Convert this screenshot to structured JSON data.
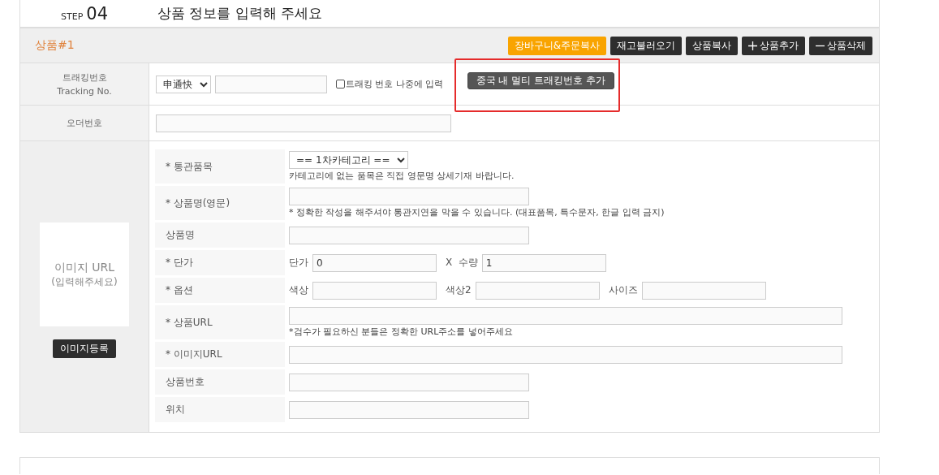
{
  "step": {
    "label": "STEP",
    "number": "04",
    "title": "상품 정보를 입력해 주세요"
  },
  "product": {
    "title": "상품#1",
    "actions": [
      {
        "label": "장바구니&주문복사",
        "kind": "highlight"
      },
      {
        "label": "재고불러오기",
        "kind": "plain"
      },
      {
        "label": "상품복사",
        "kind": "plain"
      },
      {
        "label": "상품추가",
        "kind": "add"
      },
      {
        "label": "상품삭제",
        "kind": "remove"
      }
    ],
    "tracking": {
      "label": "트래킹번호",
      "sublabel": "Tracking No.",
      "carrier": "申通快",
      "later_label": "트래킹 번호 나중에 입력",
      "later_checked": false,
      "multi_button": "중국 내 멀티 트래킹번호 추가",
      "multi_highlighted": true
    },
    "order": {
      "label": "오더번호"
    },
    "image": {
      "placeholder_line1": "이미지 URL",
      "placeholder_line2": "(입력해주세요)",
      "button": "이미지등록"
    },
    "fields": [
      {
        "label": "* 통관품목",
        "controls": [
          {
            "kind": "select",
            "value": "== 1차카테고리 =="
          }
        ],
        "note": "카테고리에 없는 품목은 직접 영문명 상세기재 바랍니다."
      },
      {
        "label": "* 상품명(영문)",
        "controls": [
          {
            "kind": "input"
          }
        ],
        "note": "* 정확한 작성을 해주셔야 통관지연을 막을 수 있습니다. (대표품목, 특수문자, 한글 입력 금지)"
      },
      {
        "label": "상품명",
        "controls": [
          {
            "kind": "input"
          }
        ]
      },
      {
        "label": "* 단가",
        "controls": [
          {
            "kind": "short-input",
            "prefix": "단가",
            "value": "0"
          },
          {
            "kind": "short-input",
            "prefix": "X  수량",
            "value": "1"
          }
        ]
      },
      {
        "label": "* 옵션",
        "controls": [
          {
            "kind": "short-input",
            "prefix": "색상"
          },
          {
            "kind": "short-input",
            "prefix": "색상2"
          },
          {
            "kind": "short-input",
            "prefix": "사이즈"
          }
        ]
      },
      {
        "label": "* 상품URL",
        "controls": [
          {
            "kind": "wide-input"
          }
        ],
        "note": "*검수가 필요하신 분들은 정확한 URL주소를 넣어주세요"
      },
      {
        "label": "* 이미지URL",
        "controls": [
          {
            "kind": "wide-input"
          }
        ]
      },
      {
        "label": "상품번호",
        "controls": [
          {
            "kind": "input"
          }
        ]
      },
      {
        "label": "위치",
        "controls": [
          {
            "kind": "input"
          }
        ]
      }
    ]
  }
}
